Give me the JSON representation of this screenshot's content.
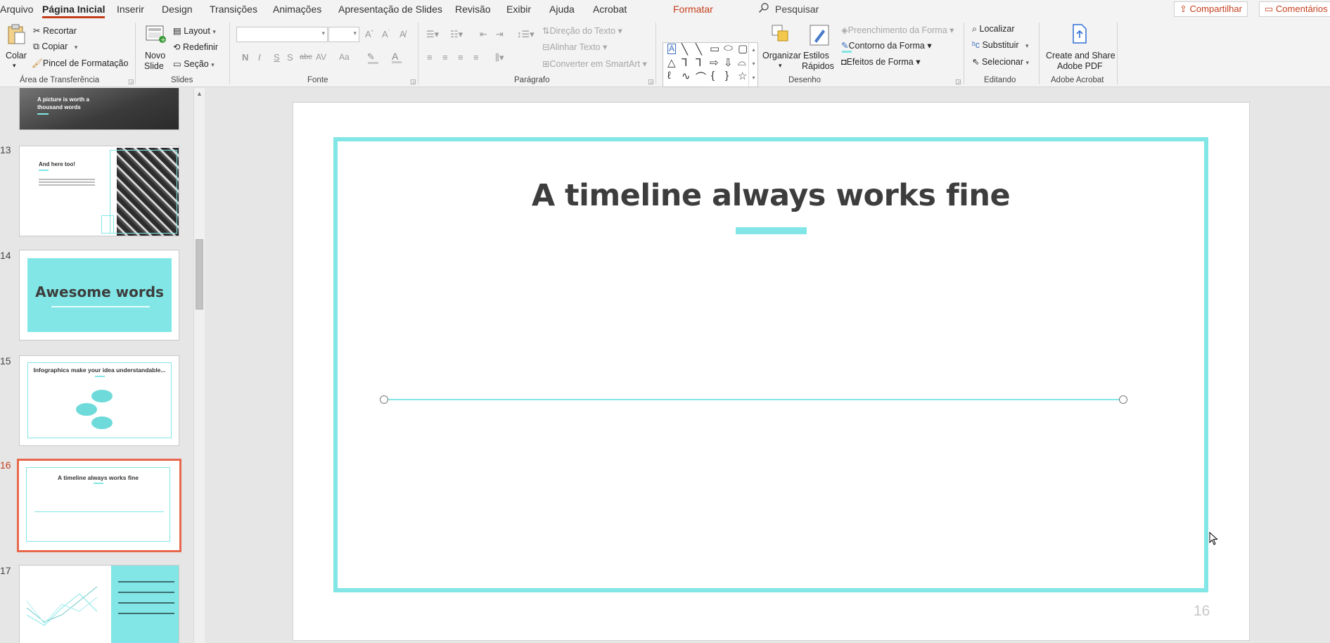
{
  "menu": {
    "tabs": [
      "Arquivo",
      "Página Inicial",
      "Inserir",
      "Design",
      "Transições",
      "Animações",
      "Apresentação de Slides",
      "Revisão",
      "Exibir",
      "Ajuda",
      "Acrobat"
    ],
    "context_tab": "Formatar",
    "search_label": "Pesquisar",
    "share_label": "Compartilhar",
    "comments_label": "Comentários"
  },
  "ribbon": {
    "clipboard": {
      "paste": "Colar",
      "cut": "Recortar",
      "copy": "Copiar",
      "format_painter": "Pincel de Formatação",
      "label": "Área de Transferência"
    },
    "slides": {
      "new_slide": "Novo",
      "new_slide_2": "Slide",
      "layout": "Layout",
      "reset": "Redefinir",
      "section": "Seção",
      "label": "Slides"
    },
    "font": {
      "bold": "N",
      "italic": "I",
      "underline": "S",
      "shadow": "S",
      "strike": "abc",
      "spacing": "AV",
      "case": "Aa",
      "label": "Fonte"
    },
    "paragraph": {
      "text_direction": "Direção do Texto",
      "align_text": "Alinhar Texto",
      "convert_smartart": "Converter em SmartArt",
      "label": "Parágrafo"
    },
    "drawing": {
      "arrange": "Organizar",
      "quick_styles_1": "Estilos",
      "quick_styles_2": "Rápidos",
      "shape_fill": "Preenchimento da Forma",
      "shape_outline": "Contorno da Forma",
      "shape_effects": "Efeitos de Forma",
      "label": "Desenho"
    },
    "editing": {
      "find": "Localizar",
      "replace": "Substituir",
      "select": "Selecionar",
      "label": "Editando"
    },
    "acrobat": {
      "create_share_1": "Create and Share",
      "create_share_2": "Adobe PDF",
      "label": "Adobe Acrobat"
    }
  },
  "thumbnails": [
    {
      "num": "",
      "title": "A picture is worth a thousand words"
    },
    {
      "num": "13",
      "title": "And here too!"
    },
    {
      "num": "14",
      "title": "Awesome words"
    },
    {
      "num": "15",
      "title": "Infographics make your idea understandable..."
    },
    {
      "num": "16",
      "title": "A timeline always works fine"
    },
    {
      "num": "17",
      "title": ""
    }
  ],
  "slide": {
    "title": "A timeline always works fine",
    "page_number": "16"
  },
  "colors": {
    "accent": "#82e6e6",
    "office_red": "#c43e1c",
    "selection": "#e8674c"
  }
}
